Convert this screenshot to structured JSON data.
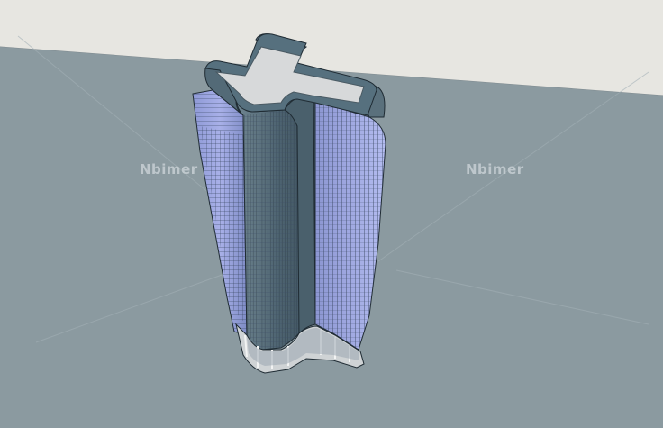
{
  "scene": {
    "sky_color": "#e7e6e1",
    "ground_color": "#8b9aa0",
    "facade_blue": "#9ea9dd",
    "facade_dark": "#4e6470",
    "roof_color": "#d7d9da",
    "mullion_color": "#3c4a66"
  },
  "watermarks": [
    "Nbimer",
    "Nbimer"
  ]
}
